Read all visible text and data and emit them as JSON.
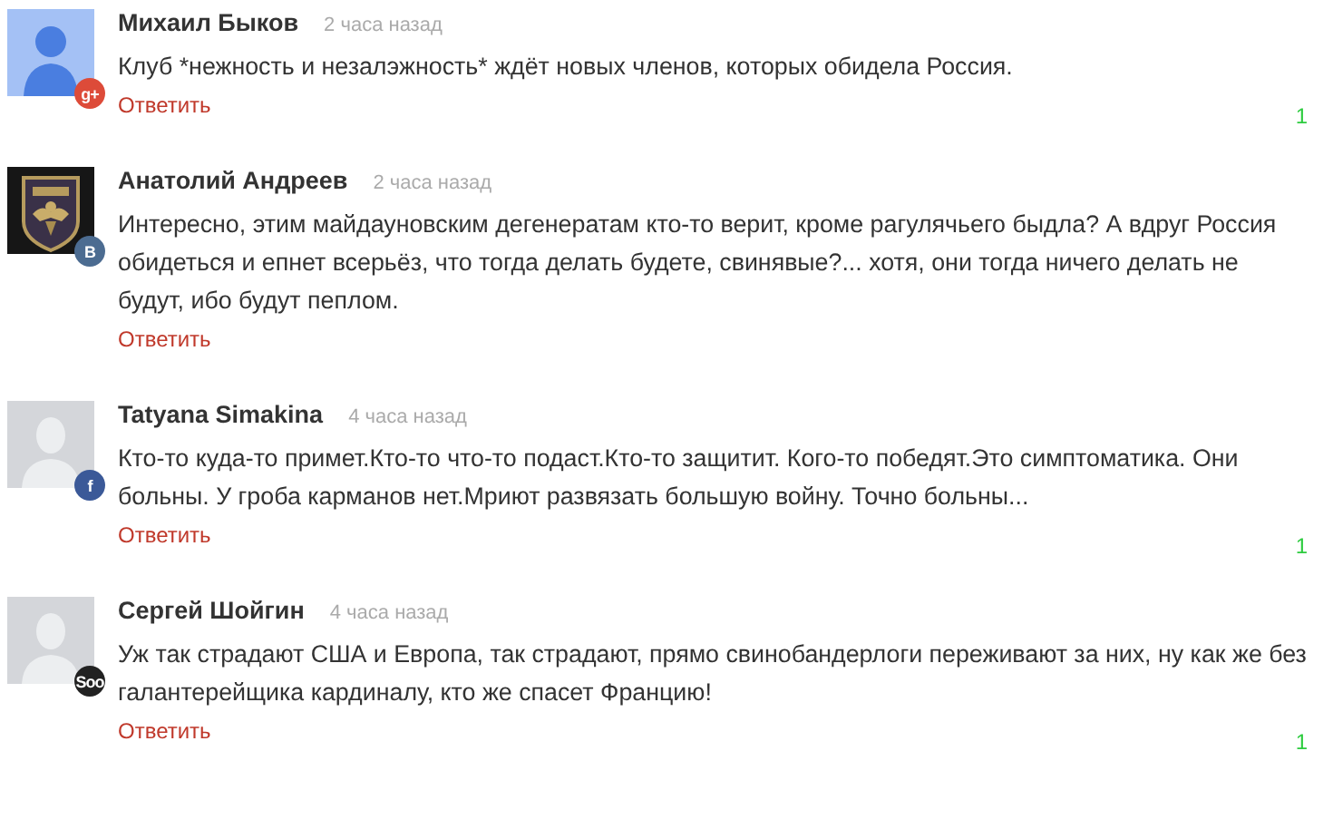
{
  "comments": [
    {
      "author": "Михаил Быков",
      "time": "2 часа назад",
      "avatar": {
        "kind": "person",
        "badge": "g+",
        "color": "#dd4b39"
      },
      "text": "Клуб *нежность и незалэжность* ждёт новых членов,  которых обидела Россия.",
      "reply": "Ответить",
      "score": "1"
    },
    {
      "author": "Анатолий Андреев",
      "time": "2 часа назад",
      "avatar": {
        "kind": "picture",
        "badge": "B",
        "color": "#4c6c91"
      },
      "text": "Интересно, этим майдауновским дегенератам кто-то верит, кроме рагулячьего быдла? А вдруг Россия обидеться и епнет всерьёз, что тогда делать будете, свинявые?... хотя, они тогда ничего делать не будут, ибо будут пеплом.",
      "reply": "Ответить"
    },
    {
      "author": "Tatyana Simakina",
      "time": "4 часа назад",
      "avatar": {
        "kind": "silhouette",
        "badge": "f",
        "color": "#3b5998"
      },
      "text": "Кто-то куда-то примет.Кто-то что-то подаст.Кто-то защитит. Кого-то победят.Это симптоматика. Они больны. У гроба карманов нет.Мриют развязать большую войну. Точно больны...",
      "reply": "Ответить",
      "score": "1"
    },
    {
      "author": "Сергей Шойгин",
      "time": "4 часа назад",
      "avatar": {
        "kind": "silhouette",
        "badge": "Soo",
        "color": "#222222"
      },
      "text": "Уж так страдают США и Европа, так страдают, прямо свинобандерлоги переживают за них, ну как же без галантерейщика кардиналу, кто же спасет Францию!",
      "reply": "Ответить",
      "score": "1"
    }
  ]
}
